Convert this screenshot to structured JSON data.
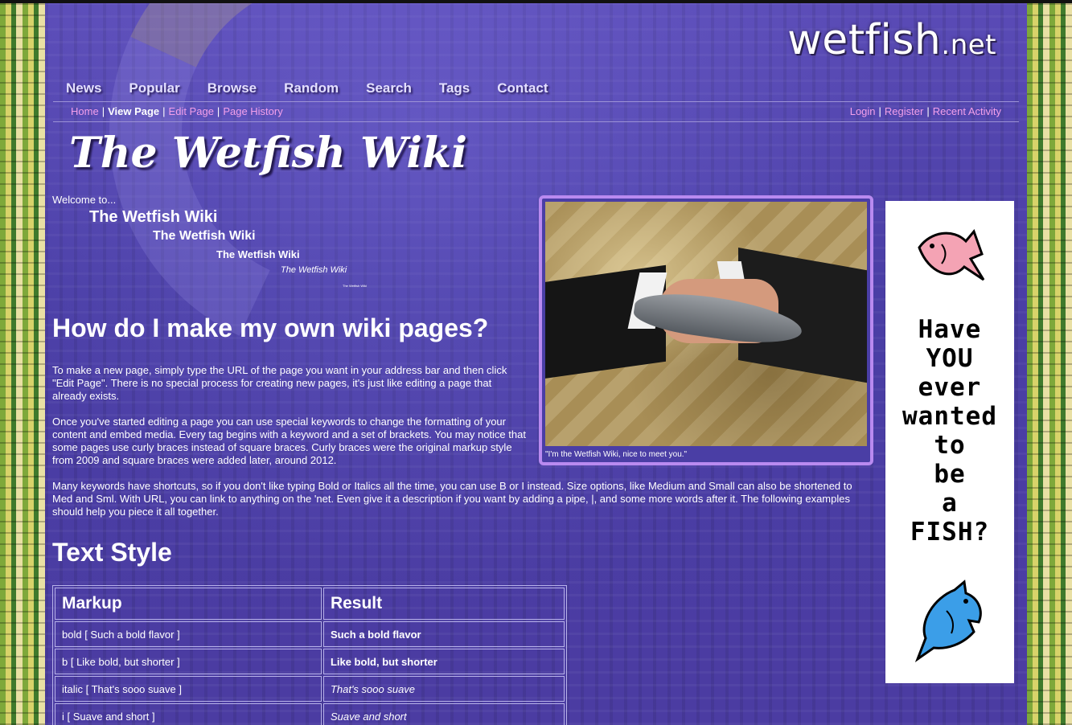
{
  "site": {
    "logo_name": "wetfish",
    "logo_tld": ".net"
  },
  "top_nav": [
    "News",
    "Popular",
    "Browse",
    "Random",
    "Search",
    "Tags",
    "Contact"
  ],
  "sub_nav": {
    "home": "Home",
    "view": "View Page",
    "edit": "Edit Page",
    "history": "Page History",
    "login": "Login",
    "register": "Register",
    "recent": "Recent Activity",
    "separator": "|"
  },
  "wiki_title": "The Wetfish Wiki",
  "welcome": {
    "intro": "Welcome to...",
    "cascade": [
      "The Wetfish Wiki",
      "The Wetfish Wiki",
      "The Wetfish Wiki",
      "The Wetfish Wiki",
      "The Wetfish Wiki"
    ]
  },
  "feature": {
    "caption": "\"I'm the Wetfish Wiki, nice to meet you.\""
  },
  "content": {
    "heading": "How do I make my own wiki pages?",
    "p1": "To make a new page, simply type the URL of the page you want in your address bar and then click \"Edit Page\". There is no special process for creating new pages, it's just like editing a page that already exists.",
    "p2": "Once you've started editing a page you can use special keywords to change the formatting of your content and embed media. Every tag begins with a keyword and a set of brackets. You may notice that some pages use curly braces instead of square braces. Curly braces were the original markup style from 2009 and square braces were added later, around 2012.",
    "p3": "Many keywords have shortcuts, so if you don't like typing Bold or Italics all the time, you can use B or I instead. Size options, like Medium and Small can also be shortened to Med and Sml. With URL, you can link to anything on the 'net. Even give it a description if you want by adding a pipe, |, and some more words after it. The following examples should help you piece it all together.",
    "section": "Text Style"
  },
  "table": {
    "headers": [
      "Markup",
      "Result"
    ],
    "rows": [
      {
        "markup": "bold [ Such a bold flavor ]",
        "result": "Such a bold flavor"
      },
      {
        "markup": "b [ Like bold, but shorter ]",
        "result": "Like bold, but shorter"
      },
      {
        "markup": "italic [ That's sooo suave ]",
        "result": "That's sooo suave"
      },
      {
        "markup": "i [ Suave and short ]",
        "result": "Suave and short"
      }
    ]
  },
  "ad": {
    "lines": [
      "Have",
      "YOU",
      "ever",
      "wanted",
      "to",
      "be",
      "a",
      "FISH?"
    ]
  }
}
